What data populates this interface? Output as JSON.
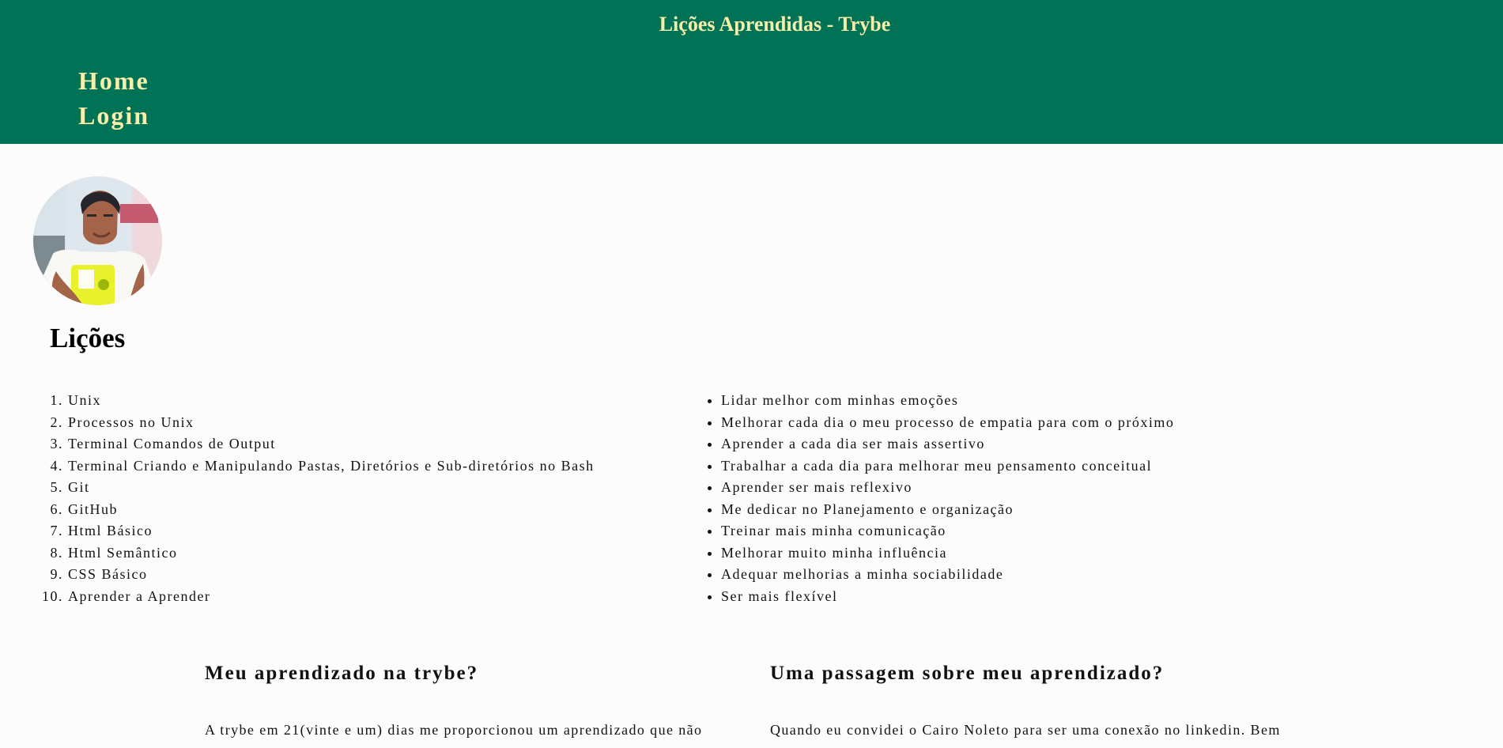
{
  "header": {
    "title": "Lições Aprendidas - Trybe",
    "nav": [
      {
        "label": "Home"
      },
      {
        "label": "Login"
      }
    ],
    "background": "#007356",
    "text_color": "#f6eea9"
  },
  "profile": {
    "avatar_icon": "profile-photo"
  },
  "lessons": {
    "title": "Lições",
    "ordered_items": [
      "Unix",
      "Processos no Unix",
      "Terminal Comandos de Output",
      "Terminal Criando e Manipulando Pastas, Diretórios e Sub-diretórios no Bash",
      "Git",
      "GitHub",
      "Html Básico",
      "Html Semântico",
      "CSS Básico",
      "Aprender a Aprender"
    ],
    "bullet_items": [
      "Lidar melhor com minhas emoções",
      "Melhorar cada dia o meu processo de empatia para com o próximo",
      "Aprender a cada dia ser mais assertivo",
      "Trabalhar a cada dia para melhorar meu pensamento conceitual",
      "Aprender ser mais reflexivo",
      "Me dedicar no Planejamento e organização",
      "Treinar mais minha comunicação",
      "Melhorar muito minha influência",
      "Adequar melhorias a minha sociabilidade",
      "Ser mais flexível"
    ]
  },
  "articles": {
    "left": {
      "title": "Meu aprendizado na trybe?",
      "text": "A trybe em 21(vinte e um) dias me proporcionou um aprendizado que não"
    },
    "right": {
      "title": "Uma passagem sobre meu aprendizado?",
      "text": "Quando eu convidei o Cairo Noleto para ser uma conexão no linkedin. Bem"
    }
  }
}
